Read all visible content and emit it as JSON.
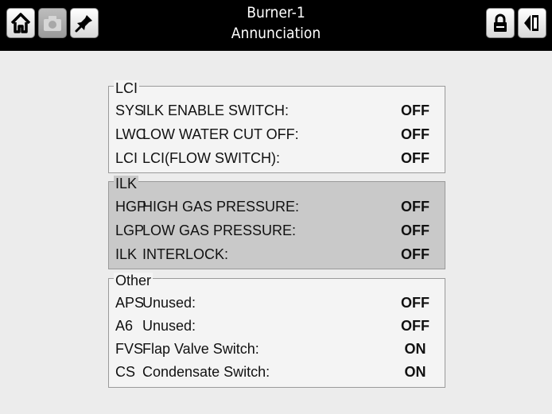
{
  "header": {
    "title_line1": "Burner-1",
    "title_line2": "Annunciation",
    "icons": [
      "home-icon",
      "camera-icon",
      "pin-icon",
      "lock-icon",
      "back-icon"
    ]
  },
  "groups": [
    {
      "label": "LCI",
      "rows": [
        {
          "code": "SYS",
          "name": "ILK ENABLE SWITCH:",
          "state": "OFF"
        },
        {
          "code": "LWC",
          "name": "LOW WATER CUT OFF:",
          "state": "OFF"
        },
        {
          "code": "LCI",
          "name": "LCI(FLOW SWITCH):",
          "state": "OFF"
        }
      ]
    },
    {
      "label": "ILK",
      "rows": [
        {
          "code": "HGP",
          "name": "HIGH GAS PRESSURE:",
          "state": "OFF"
        },
        {
          "code": "LGP",
          "name": "LOW GAS PRESSURE:",
          "state": "OFF"
        },
        {
          "code": "ILK",
          "name": "INTERLOCK:",
          "state": "OFF"
        }
      ]
    },
    {
      "label": "Other",
      "rows": [
        {
          "code": "APS",
          "name": "Unused:",
          "state": "OFF"
        },
        {
          "code": "A6",
          "name": "Unused:",
          "state": "OFF"
        },
        {
          "code": "FVS",
          "name": "Flap Valve Switch:",
          "state": "ON"
        },
        {
          "code": "CS",
          "name": "Condensate Switch:",
          "state": "ON"
        }
      ]
    }
  ]
}
